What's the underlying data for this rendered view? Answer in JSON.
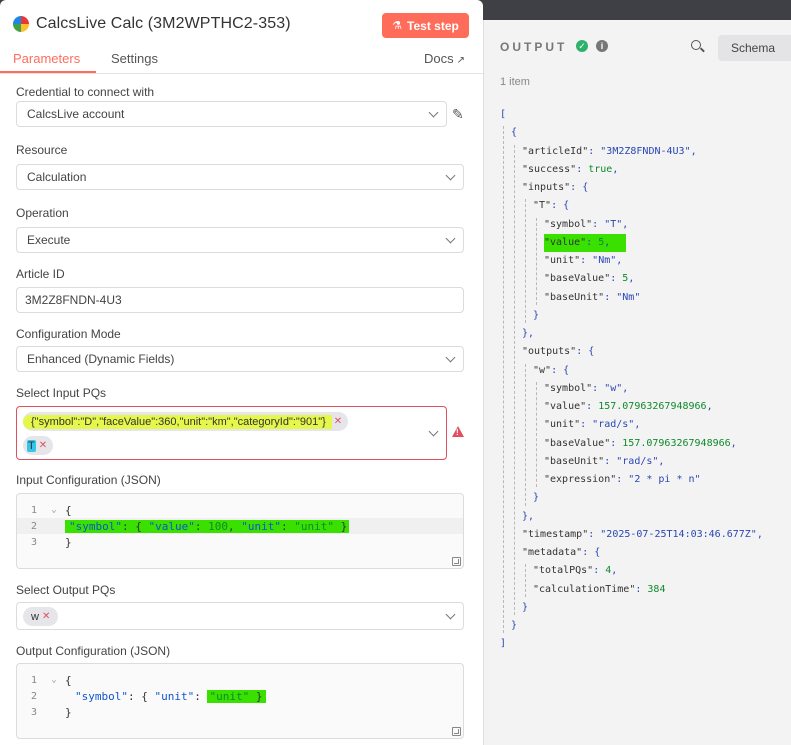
{
  "node": {
    "title": "CalcsLive Calc (3M2WPTHC2-353)",
    "test_step_label": "Test step"
  },
  "tabs": {
    "parameters": "Parameters",
    "settings": "Settings",
    "docs": "Docs"
  },
  "fields": {
    "credential": {
      "label": "Credential to connect with",
      "value": "CalcsLive account"
    },
    "resource": {
      "label": "Resource",
      "value": "Calculation"
    },
    "operation": {
      "label": "Operation",
      "value": "Execute"
    },
    "article_id": {
      "label": "Article ID",
      "value": "3M2Z8FNDN-4U3"
    },
    "config_mode": {
      "label": "Configuration Mode",
      "value": "Enhanced (Dynamic Fields)"
    },
    "input_pqs": {
      "label": "Select Input PQs",
      "chip1": "{\"symbol\":\"D\",\"faceValue\":360,\"unit\":\"km\",\"categoryId\":\"901\"}",
      "chip2": "T"
    },
    "input_config": {
      "label": "Input Configuration (JSON)",
      "lines": [
        {
          "n": "1",
          "text": "{"
        },
        {
          "n": "2",
          "key": "\"symbol\"",
          "rest": ": { ",
          "k2": "\"value\"",
          "r2": ": ",
          "num": "100",
          "r3": ", ",
          "k3": "\"unit\"",
          "r4": ": ",
          "s1": "\"unit\"",
          "r5": " }"
        },
        {
          "n": "3",
          "text": "}"
        }
      ]
    },
    "output_pqs": {
      "label": "Select Output PQs",
      "chip1": "w"
    },
    "output_config": {
      "label": "Output Configuration (JSON)",
      "lines": [
        {
          "n": "1",
          "text": "{"
        },
        {
          "n": "2",
          "key": "\"symbol\"",
          "rest": ": { ",
          "k2": "\"unit\"",
          "r2": ": ",
          "s1": "\"unit\"",
          "r3": " }"
        },
        {
          "n": "3",
          "text": "}"
        }
      ]
    }
  },
  "output": {
    "title": "OUTPUT",
    "schema_label": "Schema",
    "item_count": "1 item",
    "json": [
      {
        "i": 0,
        "t": [
          [
            "p",
            "["
          ]
        ]
      },
      {
        "i": 1,
        "t": [
          [
            "p",
            "{"
          ]
        ]
      },
      {
        "i": 2,
        "t": [
          [
            "k",
            "\"articleId\""
          ],
          [
            "p",
            ": "
          ],
          [
            "s",
            "\"3M2Z8FNDN-4U3\""
          ],
          [
            "p",
            ","
          ]
        ]
      },
      {
        "i": 2,
        "t": [
          [
            "k",
            "\"success\""
          ],
          [
            "p",
            ": "
          ],
          [
            "b",
            "true"
          ],
          [
            "p",
            ","
          ]
        ]
      },
      {
        "i": 2,
        "t": [
          [
            "k",
            "\"inputs\""
          ],
          [
            "p",
            ": {"
          ]
        ]
      },
      {
        "i": 3,
        "t": [
          [
            "k",
            "\"T\""
          ],
          [
            "p",
            ": {"
          ]
        ]
      },
      {
        "i": 4,
        "t": [
          [
            "k",
            "\"symbol\""
          ],
          [
            "p",
            ": "
          ],
          [
            "s",
            "\"T\""
          ],
          [
            "p",
            ","
          ]
        ]
      },
      {
        "i": 4,
        "t": [
          [
            "k",
            "\"value\""
          ],
          [
            "p",
            ": "
          ],
          [
            "n",
            "5"
          ],
          [
            "p",
            ","
          ]
        ],
        "hl": true
      },
      {
        "i": 4,
        "t": [
          [
            "k",
            "\"unit\""
          ],
          [
            "p",
            ": "
          ],
          [
            "s",
            "\"Nm\""
          ],
          [
            "p",
            ","
          ]
        ]
      },
      {
        "i": 4,
        "t": [
          [
            "k",
            "\"baseValue\""
          ],
          [
            "p",
            ": "
          ],
          [
            "n",
            "5"
          ],
          [
            "p",
            ","
          ]
        ]
      },
      {
        "i": 4,
        "t": [
          [
            "k",
            "\"baseUnit\""
          ],
          [
            "p",
            ": "
          ],
          [
            "s",
            "\"Nm\""
          ]
        ]
      },
      {
        "i": 3,
        "t": [
          [
            "p",
            "}"
          ]
        ]
      },
      {
        "i": 2,
        "t": [
          [
            "p",
            "},"
          ]
        ]
      },
      {
        "i": 2,
        "t": [
          [
            "k",
            "\"outputs\""
          ],
          [
            "p",
            ": {"
          ]
        ]
      },
      {
        "i": 3,
        "t": [
          [
            "k",
            "\"w\""
          ],
          [
            "p",
            ": {"
          ]
        ]
      },
      {
        "i": 4,
        "t": [
          [
            "k",
            "\"symbol\""
          ],
          [
            "p",
            ": "
          ],
          [
            "s",
            "\"w\""
          ],
          [
            "p",
            ","
          ]
        ]
      },
      {
        "i": 4,
        "t": [
          [
            "k",
            "\"value\""
          ],
          [
            "p",
            ": "
          ],
          [
            "n",
            "157.07963267948966"
          ],
          [
            "p",
            ","
          ]
        ]
      },
      {
        "i": 4,
        "t": [
          [
            "k",
            "\"unit\""
          ],
          [
            "p",
            ": "
          ],
          [
            "s",
            "\"rad/s\""
          ],
          [
            "p",
            ","
          ]
        ]
      },
      {
        "i": 4,
        "t": [
          [
            "k",
            "\"baseValue\""
          ],
          [
            "p",
            ": "
          ],
          [
            "n",
            "157.07963267948966"
          ],
          [
            "p",
            ","
          ]
        ]
      },
      {
        "i": 4,
        "t": [
          [
            "k",
            "\"baseUnit\""
          ],
          [
            "p",
            ": "
          ],
          [
            "s",
            "\"rad/s\""
          ],
          [
            "p",
            ","
          ]
        ]
      },
      {
        "i": 4,
        "t": [
          [
            "k",
            "\"expression\""
          ],
          [
            "p",
            ": "
          ],
          [
            "s",
            "\"2 * pi * n\""
          ]
        ]
      },
      {
        "i": 3,
        "t": [
          [
            "p",
            "}"
          ]
        ]
      },
      {
        "i": 2,
        "t": [
          [
            "p",
            "},"
          ]
        ]
      },
      {
        "i": 2,
        "t": [
          [
            "k",
            "\"timestamp\""
          ],
          [
            "p",
            ": "
          ],
          [
            "s",
            "\"2025-07-25T14:03:46.677Z\""
          ],
          [
            "p",
            ","
          ]
        ]
      },
      {
        "i": 2,
        "t": [
          [
            "k",
            "\"metadata\""
          ],
          [
            "p",
            ": {"
          ]
        ]
      },
      {
        "i": 3,
        "t": [
          [
            "k",
            "\"totalPQs\""
          ],
          [
            "p",
            ": "
          ],
          [
            "n",
            "4"
          ],
          [
            "p",
            ","
          ]
        ]
      },
      {
        "i": 3,
        "t": [
          [
            "k",
            "\"calculationTime\""
          ],
          [
            "p",
            ": "
          ],
          [
            "n",
            "384"
          ]
        ]
      },
      {
        "i": 2,
        "t": [
          [
            "p",
            "}"
          ]
        ]
      },
      {
        "i": 1,
        "t": [
          [
            "p",
            "}"
          ]
        ]
      },
      {
        "i": 0,
        "t": [
          [
            "p",
            "]"
          ]
        ]
      }
    ]
  },
  "colors": {
    "accent": "#ff6d5a",
    "error": "#e0505e",
    "success": "#2eb26b"
  }
}
